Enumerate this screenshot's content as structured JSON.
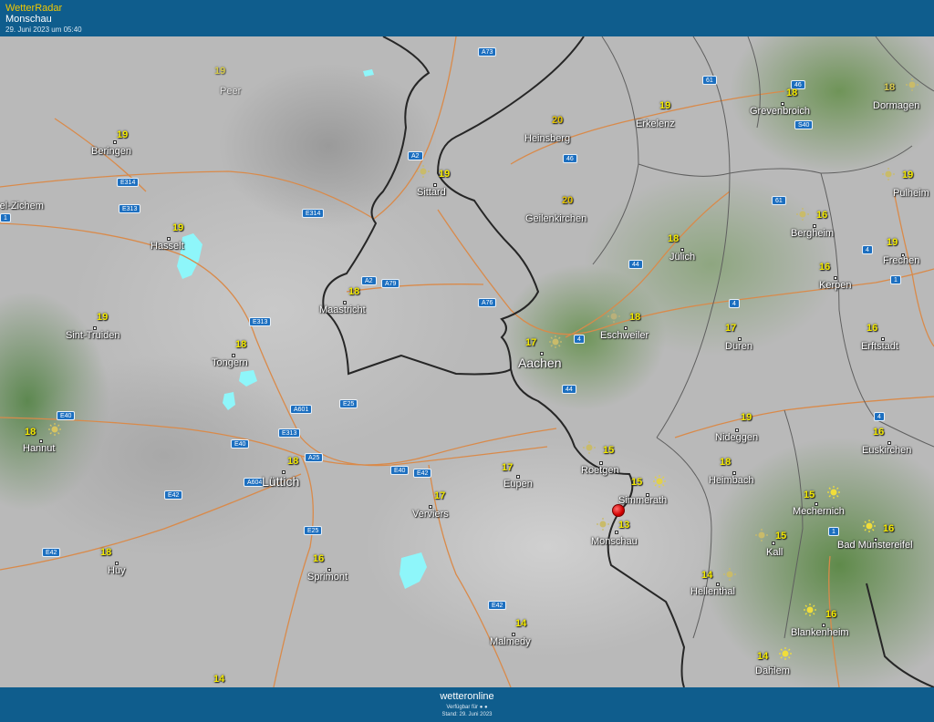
{
  "header": {
    "app_title": "WetterRadar",
    "location": "Monschau",
    "timestamp": "29. Juni 2023 um 05:40"
  },
  "cities": [
    {
      "key": "peer",
      "name": "Peer",
      "temp": "19",
      "icon": "none"
    },
    {
      "key": "beringen",
      "name": "Beringen",
      "temp": "19",
      "icon": "none"
    },
    {
      "key": "zichem",
      "name": "rel-Zichem",
      "temp": "",
      "icon": "none"
    },
    {
      "key": "hasselt",
      "name": "Hasselt",
      "temp": "19",
      "icon": "none"
    },
    {
      "key": "sint-truiden",
      "name": "Sint-Truiden",
      "temp": "19",
      "icon": "none"
    },
    {
      "key": "tongern",
      "name": "Tongern",
      "temp": "18",
      "icon": "none"
    },
    {
      "key": "hannut",
      "name": "Hannut",
      "temp": "18",
      "icon": "sun-icon"
    },
    {
      "key": "luettich",
      "name": "Lüttich",
      "temp": "18",
      "icon": "none"
    },
    {
      "key": "huy",
      "name": "Huy",
      "temp": "18",
      "icon": "none"
    },
    {
      "key": "sprimont",
      "name": "Sprimont",
      "temp": "16",
      "icon": "none"
    },
    {
      "key": "verviers",
      "name": "Verviers",
      "temp": "17",
      "icon": "none"
    },
    {
      "key": "eupen",
      "name": "Eupen",
      "temp": "17",
      "icon": "none"
    },
    {
      "key": "malmedy",
      "name": "Malmedy",
      "temp": "14",
      "icon": "none"
    },
    {
      "key": "maastricht",
      "name": "Maastricht",
      "temp": "18",
      "icon": "none"
    },
    {
      "key": "sittard",
      "name": "Sittard",
      "temp": "19",
      "icon": "sun-icon"
    },
    {
      "key": "heinsberg",
      "name": "Heinsberg",
      "temp": "20",
      "icon": "none"
    },
    {
      "key": "erkelenz",
      "name": "Erkelenz",
      "temp": "19",
      "icon": "none"
    },
    {
      "key": "geilenkirchen",
      "name": "Geilenkirchen",
      "temp": "20",
      "icon": "none"
    },
    {
      "key": "aachen",
      "name": "Aachen",
      "temp": "17",
      "icon": "sun-icon"
    },
    {
      "key": "eschweiler",
      "name": "Eschweiler",
      "temp": "18",
      "icon": "sun-icon"
    },
    {
      "key": "juelich",
      "name": "Jülich",
      "temp": "18",
      "icon": "none"
    },
    {
      "key": "dueren",
      "name": "Düren",
      "temp": "17",
      "icon": "none"
    },
    {
      "key": "roetgen",
      "name": "Roetgen",
      "temp": "15",
      "icon": "sun-icon"
    },
    {
      "key": "simmerath",
      "name": "Simmerath",
      "temp": "15",
      "icon": "sun-icon"
    },
    {
      "key": "monschau",
      "name": "Monschau",
      "temp": "13",
      "icon": "sun-icon"
    },
    {
      "key": "nideggen",
      "name": "Nideggen",
      "temp": "19",
      "icon": "none"
    },
    {
      "key": "heimbach",
      "name": "Heimbach",
      "temp": "18",
      "icon": "none"
    },
    {
      "key": "hellenthal",
      "name": "Hellenthal",
      "temp": "14",
      "icon": "sun-icon"
    },
    {
      "key": "kall",
      "name": "Kall",
      "temp": "15",
      "icon": "sun-icon"
    },
    {
      "key": "mechernich",
      "name": "Mechernich",
      "temp": "15",
      "icon": "sun-icon"
    },
    {
      "key": "bad-muenstereifel",
      "name": "Bad Münstereifel",
      "temp": "16",
      "icon": "sun-icon"
    },
    {
      "key": "blankenheim",
      "name": "Blankenheim",
      "temp": "16",
      "icon": "sun-icon"
    },
    {
      "key": "dahlem",
      "name": "Dahlem",
      "temp": "14",
      "icon": "sun-icon"
    },
    {
      "key": "grevenbroich",
      "name": "Grevenbroich",
      "temp": "18",
      "icon": "none"
    },
    {
      "key": "dormagen",
      "name": "Dormagen",
      "temp": "18",
      "icon": "sun-icon"
    },
    {
      "key": "pulheim",
      "name": "Pulheim",
      "temp": "19",
      "icon": "sun-icon"
    },
    {
      "key": "bergheim",
      "name": "Bergheim",
      "temp": "16",
      "icon": "sun-icon"
    },
    {
      "key": "frechen",
      "name": "Frechen",
      "temp": "19",
      "icon": "none"
    },
    {
      "key": "kerpen",
      "name": "Kerpen",
      "temp": "16",
      "icon": "none"
    },
    {
      "key": "erftstadt",
      "name": "Erftstadt",
      "temp": "16",
      "icon": "none"
    },
    {
      "key": "euskirchen",
      "name": "Euskirchen",
      "temp": "16",
      "icon": "none"
    },
    {
      "key": "bottom-left",
      "name": "",
      "temp": "14",
      "icon": "none"
    }
  ],
  "roads": [
    "A73",
    "A2",
    "E314",
    "E313",
    "E314",
    "A2",
    "A79",
    "A76",
    "E313",
    "A601",
    "E25",
    "E40",
    "E313",
    "A25",
    "A604",
    "E42",
    "E40",
    "E42",
    "E40",
    "E25",
    "E42",
    "E42",
    "61",
    "46",
    "46",
    "S40",
    "61",
    "4",
    "44",
    "4",
    "4",
    "44",
    "1",
    "4",
    "1",
    "1"
  ],
  "footer": {
    "brand": "wetteronline",
    "available": "Verfügbar für",
    "stand": "Stand: 29. Juni 2023"
  },
  "colors": {
    "header_bg": "#0f5d8d",
    "title": "#f2c800",
    "temperature": "#f4ea00",
    "road_shield": "#1c6fc0",
    "border": "#2a2a2a",
    "road_line": "#d98a4a"
  }
}
